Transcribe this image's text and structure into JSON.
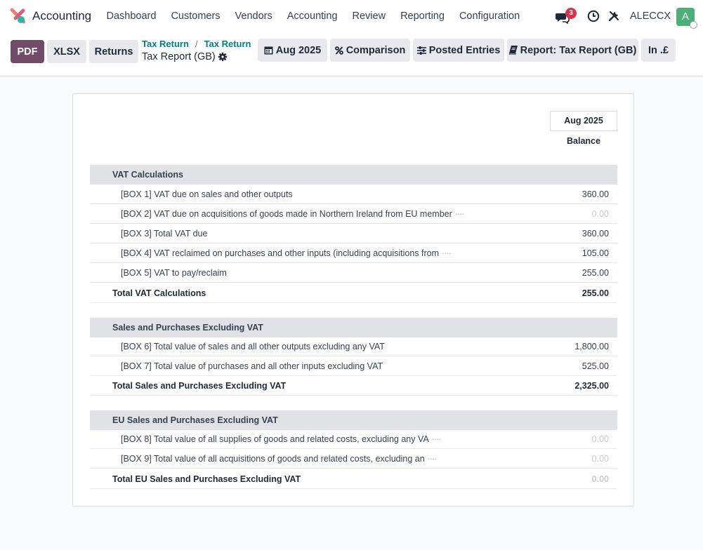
{
  "app": {
    "name": "Accounting"
  },
  "menu": [
    "Dashboard",
    "Customers",
    "Vendors",
    "Accounting",
    "Review",
    "Reporting",
    "Configuration"
  ],
  "systray": {
    "chat_count": "3",
    "company": "ALECCX",
    "avatar_letter": "A"
  },
  "toolbar": {
    "pdf": "PDF",
    "xlsx": "XLSX",
    "returns": "Returns",
    "period": "Aug 2025",
    "comparison": "Comparison",
    "posted_entries": "Posted Entries",
    "report": "Report: Tax Report (GB)",
    "currency": "In .£"
  },
  "breadcrumb": {
    "first": "Tax Return",
    "second": "Tax Return",
    "title": "Tax Report (GB)"
  },
  "report": {
    "period": "Aug 2025",
    "column": "Balance",
    "sections": [
      {
        "title": "VAT Calculations",
        "lines": [
          {
            "label": "[BOX 1] VAT due on sales and other outputs",
            "value": "360.00",
            "truncated": ""
          },
          {
            "label": "[BOX 2] VAT due on acquisitions of goods made in Northern Ireland from EU member",
            "value": "0.00",
            "truncated": "····"
          },
          {
            "label": "[BOX 3] Total VAT due",
            "value": "360.00",
            "truncated": ""
          },
          {
            "label": "[BOX 4] VAT reclaimed on purchases and other inputs (including acquisitions from",
            "value": "105.00",
            "truncated": "····"
          },
          {
            "label": "[BOX 5] VAT to pay/reclaim",
            "value": "255.00",
            "truncated": ""
          }
        ],
        "total_label": "Total VAT Calculations",
        "total_value": "255.00"
      },
      {
        "title": "Sales and Purchases Excluding VAT",
        "lines": [
          {
            "label": "[BOX 6] Total value of sales and all other outputs excluding any VAT",
            "value": "1,800.00",
            "truncated": ""
          },
          {
            "label": "[BOX 7] Total value of purchases and all other inputs excluding VAT",
            "value": "525.00",
            "truncated": ""
          }
        ],
        "total_label": "Total Sales and Purchases Excluding VAT",
        "total_value": "2,325.00"
      },
      {
        "title": "EU Sales and Purchases Excluding VAT",
        "lines": [
          {
            "label": "[BOX 8] Total value of all supplies of goods and related costs, excluding any VA",
            "value": "0.00",
            "truncated": "····"
          },
          {
            "label": "[BOX 9] Total value of all acquisitions of goods and related costs, excluding an",
            "value": "0.00",
            "truncated": "····"
          }
        ],
        "total_label": "Total EU Sales and Purchases Excluding VAT",
        "total_value": "0.00"
      }
    ]
  },
  "colors": {
    "primary": "#714b67",
    "link": "#017e84",
    "badge": "#d9314b",
    "avatar": "#4caf7a"
  }
}
